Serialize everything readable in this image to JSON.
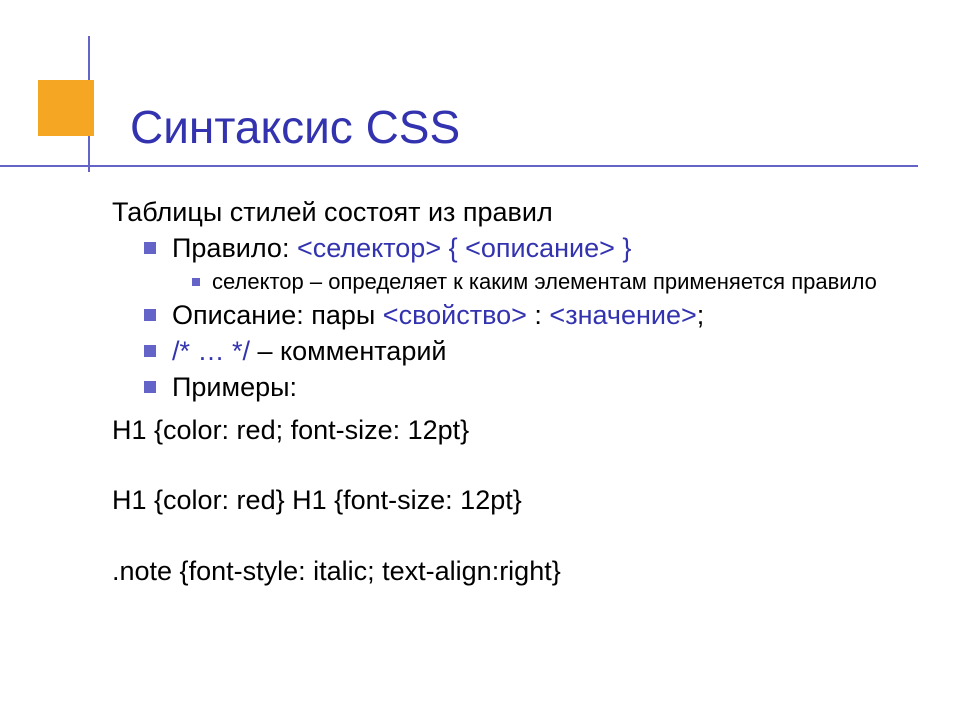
{
  "title": "Синтаксис CSS",
  "main_text": "Таблицы стилей состоят из правил",
  "bullets": {
    "rule_label": "Правило: ",
    "rule_selector": "<селектор>",
    "rule_brace_open": " { ",
    "rule_desc": "<описание>",
    "rule_brace_close": " }",
    "selector_note": "селектор – определяет к каким элементам применяется правило",
    "desc_label": "Описание: пары ",
    "desc_prop": "<свойство>",
    "desc_colon": " : ",
    "desc_val": "<значение>",
    "desc_end": ";",
    "comment_syntax": "/* … */",
    "comment_label": " – комментарий",
    "examples_label": "Примеры:"
  },
  "examples": {
    "ex1": "H1 {color: red; font-size: 12pt}",
    "ex2": "H1 {color: red} H1 {font-size: 12pt}",
    "ex3": ".note {font-style: italic; text-align:right}"
  }
}
